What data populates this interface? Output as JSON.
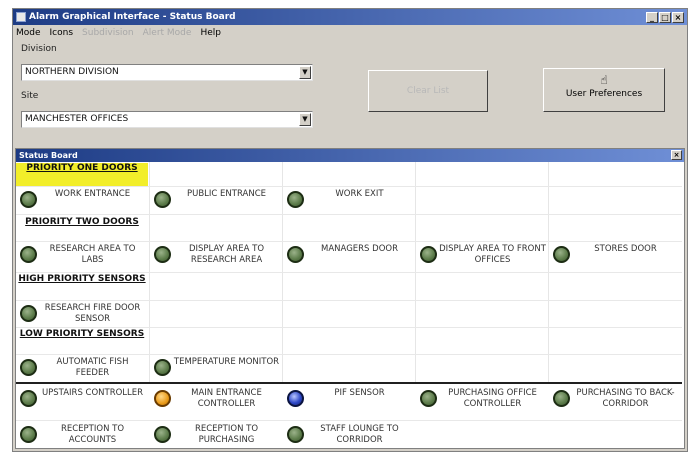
{
  "window": {
    "title": "Alarm Graphical Interface - Status Board",
    "min": "_",
    "max": "□",
    "close": "×"
  },
  "menu": [
    "Mode",
    "Icons",
    "Subdivision",
    "Alert Mode",
    "Help"
  ],
  "division": {
    "label": "Division",
    "value": "NORTHERN DIVISION"
  },
  "site": {
    "label": "Site",
    "value": "MANCHESTER OFFICES"
  },
  "buttons": {
    "disabled_label": "Clear List",
    "user_pref_label": "User Preferences",
    "user_pref_icon": "hand-icon"
  },
  "statusboard": {
    "title": "Status Board",
    "close": "×",
    "groups": [
      {
        "header": "PRIORITY ONE DOORS",
        "highlight": "#f2ee2a",
        "items": [
          {
            "label": "WORK ENTRANCE",
            "color": "green"
          },
          {
            "label": "PUBLIC ENTRANCE",
            "color": "green"
          },
          {
            "label": "WORK EXIT",
            "color": "green"
          }
        ]
      },
      {
        "header": "PRIORITY TWO DOORS",
        "items": [
          {
            "label": "RESEARCH AREA TO LABS",
            "color": "green"
          },
          {
            "label": "DISPLAY AREA TO RESEARCH AREA",
            "color": "green"
          },
          {
            "label": "MANAGERS DOOR",
            "color": "green"
          },
          {
            "label": "DISPLAY AREA TO FRONT OFFICES",
            "color": "green"
          },
          {
            "label": "STORES DOOR",
            "color": "green"
          }
        ]
      },
      {
        "header": "HIGH PRIORITY SENSORS",
        "items": [
          {
            "label": "RESEARCH FIRE DOOR SENSOR",
            "color": "green"
          }
        ]
      },
      {
        "header": "LOW PRIORITY SENSORS",
        "items": [
          {
            "label": "AUTOMATIC FISH FEEDER",
            "color": "green"
          },
          {
            "label": "TEMPERATURE MONITOR",
            "color": "green"
          }
        ]
      }
    ],
    "controllers": [
      {
        "label": "UPSTAIRS CONTROLLER",
        "color": "green"
      },
      {
        "label": "MAIN ENTRANCE CONTROLLER",
        "color": "orange"
      },
      {
        "label": "PIF SENSOR",
        "color": "blue"
      },
      {
        "label": "PURCHASING OFFICE CONTROLLER",
        "color": "green"
      },
      {
        "label": "PURCHASING TO BACK-CORRIDOR",
        "color": "green"
      },
      {
        "label": "RECEPTION TO ACCOUNTS",
        "color": "green"
      },
      {
        "label": "RECEPTION TO PURCHASING",
        "color": "green"
      },
      {
        "label": "STAFF LOUNGE TO CORRIDOR",
        "color": "green"
      }
    ]
  }
}
